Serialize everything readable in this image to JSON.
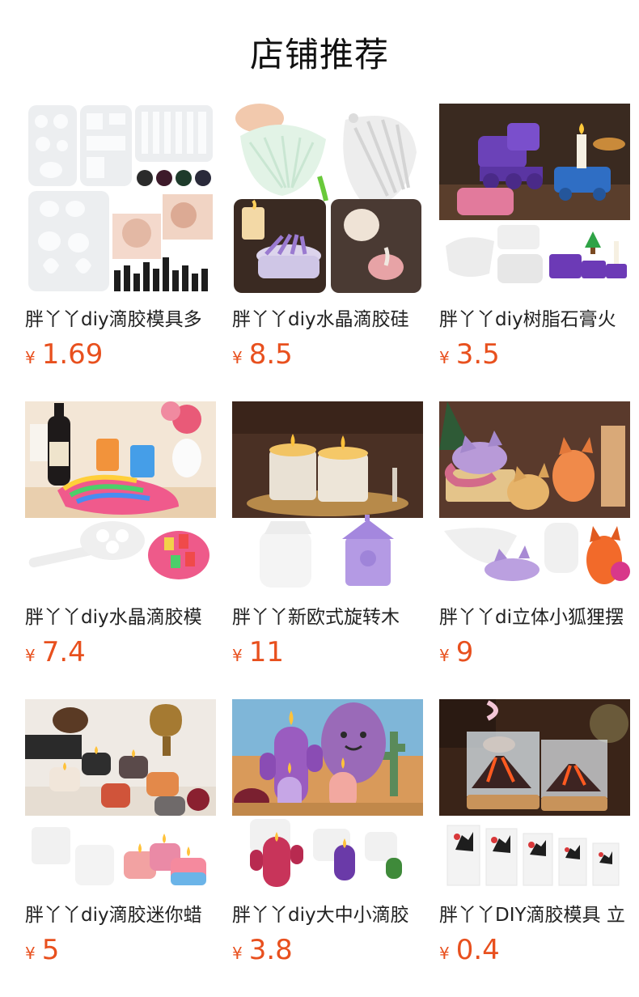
{
  "section": {
    "title": "店铺推荐"
  },
  "colors": {
    "price": "#e8501e",
    "text": "#222222",
    "background": "#ffffff"
  },
  "products": [
    {
      "name": "胖丫丫diy滴胶模具多",
      "currency": "¥",
      "price": "1.69",
      "image": "assorted-silicone-pendant-molds-earrings"
    },
    {
      "name": "胖丫丫diy水晶滴胶硅",
      "currency": "¥",
      "price": "8.5",
      "image": "shell-pouring-cup-molds-candle"
    },
    {
      "name": "胖丫丫diy树脂石膏火",
      "currency": "¥",
      "price": "3.5",
      "image": "train-candle-molds"
    },
    {
      "name": "胖丫丫diy水晶滴胶模",
      "currency": "¥",
      "price": "7.4",
      "image": "rainbow-serving-tray-wine"
    },
    {
      "name": "胖丫丫新欧式旋转木",
      "currency": "¥",
      "price": "11",
      "image": "carousel-candle-holders"
    },
    {
      "name": "胖丫丫di立体小狐狸摆",
      "currency": "¥",
      "price": "9",
      "image": "fox-figurine-molds"
    },
    {
      "name": "胖丫丫diy滴胶迷你蜡",
      "currency": "¥",
      "price": "5",
      "image": "mini-cube-candle-molds"
    },
    {
      "name": "胖丫丫diy大中小滴胶",
      "currency": "¥",
      "price": "3.8",
      "image": "cactus-candle-molds"
    },
    {
      "name": "胖丫丫DIY滴胶模具 立",
      "currency": "¥",
      "price": "0.4",
      "image": "volcano-resin-lamp-molds"
    }
  ]
}
